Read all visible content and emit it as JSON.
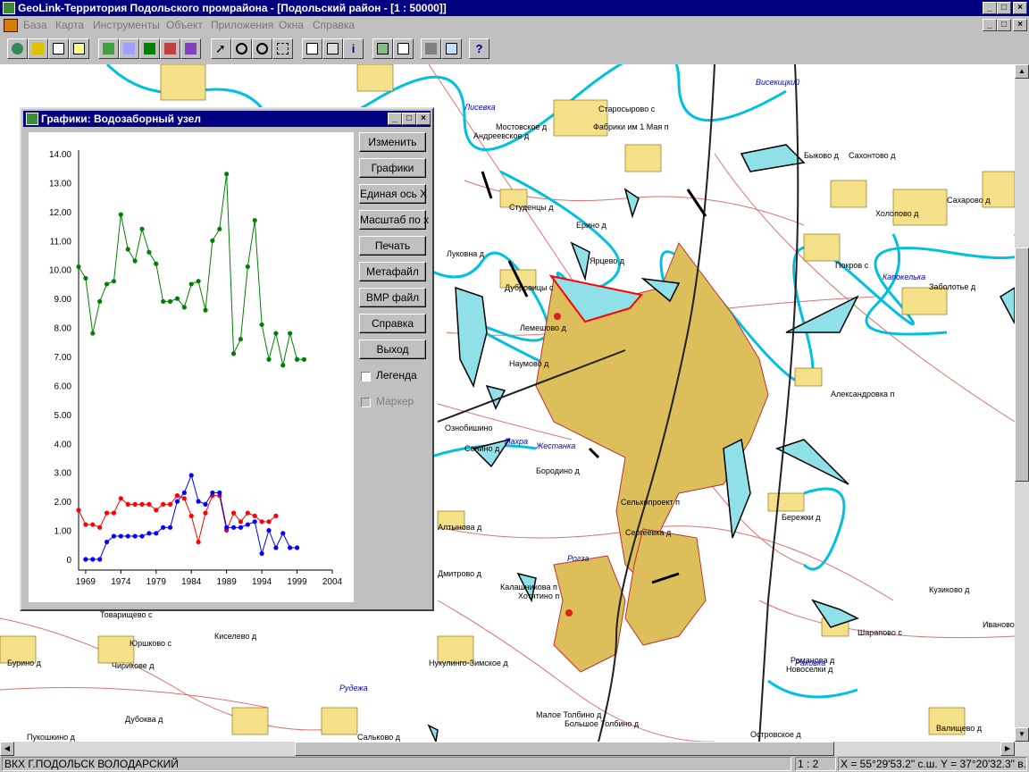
{
  "app": {
    "title": "GeoLink-Территория Подольского промрайона - [Подольский район - [1 : 50000]]"
  },
  "menu": [
    "База",
    "Карта",
    "Инструменты",
    "Объект",
    "Приложения",
    "Окна",
    "Справка"
  ],
  "toolbar_icons": [
    "open-icon",
    "layers-icon",
    "copy-icon",
    "export-icon",
    "edit-icon",
    "draw-icon",
    "save-icon",
    "chart-edit-icon",
    "chart-icon",
    "pointer-icon",
    "zoom-out-icon",
    "zoom-in-icon",
    "zoom-area-icon",
    "ruler-icon",
    "search-icon",
    "info-icon",
    "window-icon",
    "table-icon",
    "print-icon",
    "preview-icon",
    "help-icon"
  ],
  "chart_window": {
    "title": "Графики: Водозаборный узел",
    "buttons": [
      "Изменить",
      "Графики",
      "Единая ось X",
      "Масштаб по x",
      "Печать",
      "Метафайл",
      "BMP файл",
      "Справка",
      "Выход"
    ],
    "legend_label": "Легенда",
    "marker_label": "Маркер"
  },
  "chart_data": {
    "type": "line",
    "y_ticks": [
      "14.00",
      "13.00",
      "12.00",
      "11.00",
      "10.00",
      "9.00",
      "8.00",
      "7.00",
      "6.00",
      "5.00",
      "4.00",
      "3.00",
      "2.00",
      "1.00",
      "0"
    ],
    "x_ticks": [
      "1969",
      "1974",
      "1979",
      "1984",
      "1989",
      "1994",
      "1999",
      "2004"
    ],
    "xlim": [
      1968,
      2004
    ],
    "ylim": [
      0,
      14
    ],
    "colors": {
      "green": "#008000",
      "red": "#ff0000",
      "blue": "#0000ff"
    },
    "series": [
      {
        "color": "green",
        "points": [
          [
            1968,
            10.1
          ],
          [
            1969,
            9.7
          ],
          [
            1970,
            7.8
          ],
          [
            1971,
            8.9
          ],
          [
            1972,
            9.5
          ],
          [
            1973,
            9.6
          ],
          [
            1974,
            11.9
          ],
          [
            1975,
            10.7
          ],
          [
            1976,
            10.3
          ],
          [
            1977,
            11.4
          ],
          [
            1978,
            10.6
          ],
          [
            1979,
            10.2
          ],
          [
            1980,
            8.9
          ],
          [
            1981,
            8.9
          ],
          [
            1982,
            9.0
          ],
          [
            1983,
            8.7
          ],
          [
            1984,
            9.5
          ],
          [
            1985,
            9.6
          ],
          [
            1986,
            8.6
          ],
          [
            1987,
            11.0
          ],
          [
            1988,
            11.4
          ],
          [
            1989,
            13.3
          ],
          [
            1990,
            7.1
          ],
          [
            1991,
            7.6
          ],
          [
            1992,
            10.1
          ],
          [
            1993,
            11.7
          ],
          [
            1994,
            8.1
          ],
          [
            1995,
            6.9
          ],
          [
            1996,
            7.8
          ],
          [
            1997,
            6.7
          ],
          [
            1998,
            7.8
          ],
          [
            1999,
            6.9
          ],
          [
            2000,
            6.9
          ]
        ]
      },
      {
        "color": "red",
        "points": [
          [
            1968,
            1.7
          ],
          [
            1969,
            1.2
          ],
          [
            1970,
            1.2
          ],
          [
            1971,
            1.1
          ],
          [
            1972,
            1.6
          ],
          [
            1973,
            1.6
          ],
          [
            1974,
            2.1
          ],
          [
            1975,
            1.9
          ],
          [
            1976,
            1.9
          ],
          [
            1977,
            1.9
          ],
          [
            1978,
            1.9
          ],
          [
            1979,
            1.7
          ],
          [
            1980,
            1.9
          ],
          [
            1981,
            1.9
          ],
          [
            1982,
            2.2
          ],
          [
            1983,
            2.1
          ],
          [
            1984,
            1.5
          ],
          [
            1985,
            0.6
          ],
          [
            1986,
            1.6
          ],
          [
            1987,
            2.2
          ],
          [
            1988,
            2.2
          ],
          [
            1989,
            1.0
          ],
          [
            1990,
            1.6
          ],
          [
            1991,
            1.3
          ],
          [
            1992,
            1.6
          ],
          [
            1993,
            1.5
          ],
          [
            1994,
            1.3
          ],
          [
            1995,
            1.3
          ],
          [
            1996,
            1.5
          ]
        ]
      },
      {
        "color": "blue",
        "points": [
          [
            1969,
            0.0
          ],
          [
            1970,
            0.0
          ],
          [
            1971,
            0.0
          ],
          [
            1972,
            0.6
          ],
          [
            1973,
            0.8
          ],
          [
            1974,
            0.8
          ],
          [
            1975,
            0.8
          ],
          [
            1976,
            0.8
          ],
          [
            1977,
            0.8
          ],
          [
            1978,
            0.9
          ],
          [
            1979,
            0.9
          ],
          [
            1980,
            1.1
          ],
          [
            1981,
            1.1
          ],
          [
            1982,
            2.0
          ],
          [
            1983,
            2.3
          ],
          [
            1984,
            2.9
          ],
          [
            1985,
            2.0
          ],
          [
            1986,
            1.9
          ],
          [
            1987,
            2.3
          ],
          [
            1988,
            2.3
          ],
          [
            1989,
            1.1
          ],
          [
            1990,
            1.1
          ],
          [
            1991,
            1.1
          ],
          [
            1992,
            1.2
          ],
          [
            1993,
            1.3
          ],
          [
            1994,
            0.2
          ],
          [
            1995,
            1.0
          ],
          [
            1996,
            0.4
          ],
          [
            1997,
            0.9
          ],
          [
            1998,
            0.4
          ],
          [
            1999,
            0.4
          ]
        ]
      }
    ]
  },
  "map": {
    "labels": [
      "Старосырово с",
      "Мостовское д",
      "Андреевское д",
      "Фабрики им 1 Мая п",
      "Быково д",
      "Сахонтово д",
      "Сахарово д",
      "Холопово д",
      "Студенцы д",
      "Ерино д",
      "Луковна д",
      "Ярцево д",
      "Покров с",
      "Заболотье д",
      "Дубровицы с",
      "Лемешово д",
      "Наумово д",
      "Александровка п",
      "Сенино д",
      "Бородино д",
      "Сельхопроект п",
      "Сергеевка д",
      "Алтынова д",
      "Бережки д",
      "Дмитрово д",
      "Калашникова п",
      "Хотятино п",
      "Кузиково д",
      "Товарищево с",
      "Киселево д",
      "Шарапово с",
      "Бурино д",
      "Юршково с",
      "Чирикове д",
      "Нукулинго-Зимское д",
      "Романова д",
      "Новоселки д",
      "Малое Толбино д",
      "Большое Толбино д",
      "Сальково д",
      "Пукошкино д",
      "Дубоква д",
      "Валищево д",
      "Ознобишино",
      "Островское д",
      "Иваново"
    ],
    "river_labels": [
      "Лисевка",
      "Висекицкий",
      "Капокелька",
      "Пахра",
      "Жестанка",
      "Рогза",
      "Рудежа",
      "Раковка"
    ]
  },
  "status": {
    "left": "ВКХ Г.ПОДОЛЬСК ВОЛОДАРСКИЙ",
    "scale": "1 : 2",
    "coords": "X = 55°29'53.2\" с.ш.  Y = 37°20'32.3\" в.д."
  }
}
